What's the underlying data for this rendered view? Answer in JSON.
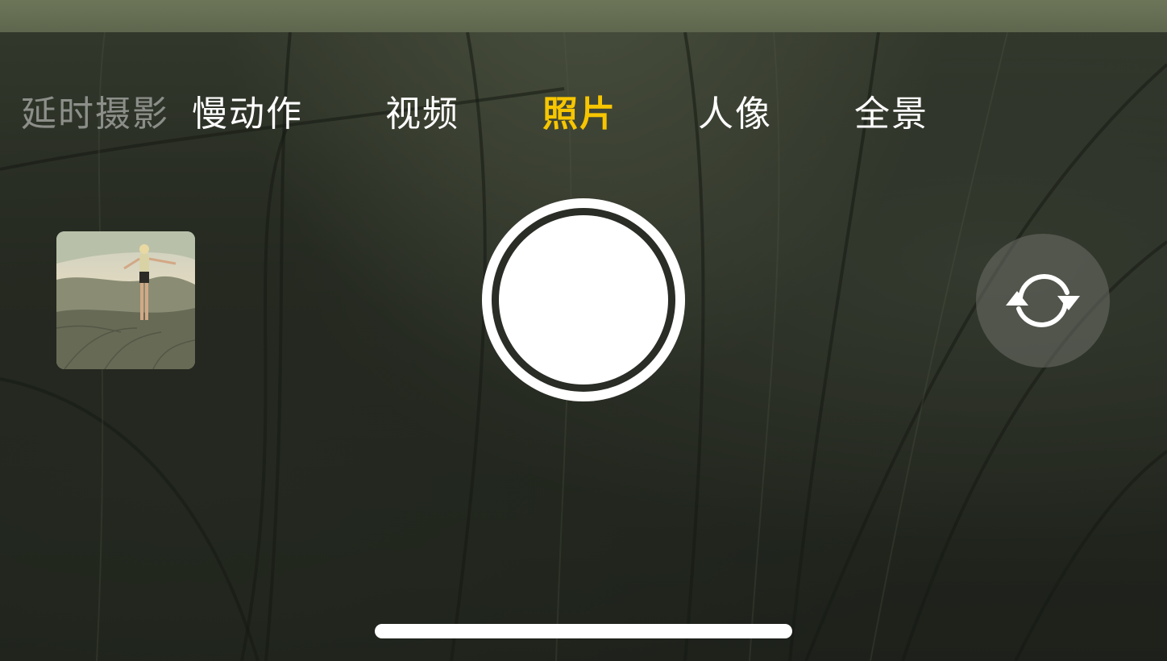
{
  "modes": {
    "timelapse": "延时摄影",
    "slowmo": "慢动作",
    "video": "视频",
    "photo": "照片",
    "portrait": "人像",
    "pano": "全景"
  },
  "active_mode": "照片",
  "icons": {
    "flip": "camera-flip-icon"
  },
  "colors": {
    "active_mode": "#f7c600",
    "inactive_mode": "#ffffff",
    "shutter": "#ffffff"
  }
}
